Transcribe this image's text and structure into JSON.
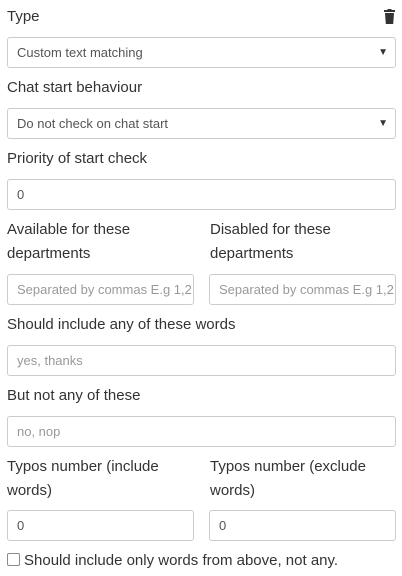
{
  "type": {
    "label": "Type",
    "value": "Custom text matching",
    "delete_icon": "trash-icon"
  },
  "chat_start": {
    "label": "Chat start behaviour",
    "value": "Do not check on chat start"
  },
  "priority": {
    "label": "Priority of start check",
    "value": "0"
  },
  "departments": {
    "available_label_1": "Available for these",
    "available_label_2": "departments",
    "available_placeholder": "Separated by commas E.g 1,2",
    "disabled_label_1": "Disabled for these",
    "disabled_label_2": "departments",
    "disabled_placeholder": "Separated by commas E.g 1,2"
  },
  "include_words": {
    "label": "Should include any of these words",
    "placeholder": "yes, thanks"
  },
  "exclude_words": {
    "label": "But not any of these",
    "placeholder": "no, nop"
  },
  "typos": {
    "include_label_1": "Typos number (include",
    "include_label_2": "words)",
    "include_value": "0",
    "exclude_label_1": "Typos number (exclude",
    "exclude_label_2": "words)",
    "exclude_value": "0"
  },
  "only_words": {
    "label": "Should include only words from above, not any.",
    "checked": false
  }
}
